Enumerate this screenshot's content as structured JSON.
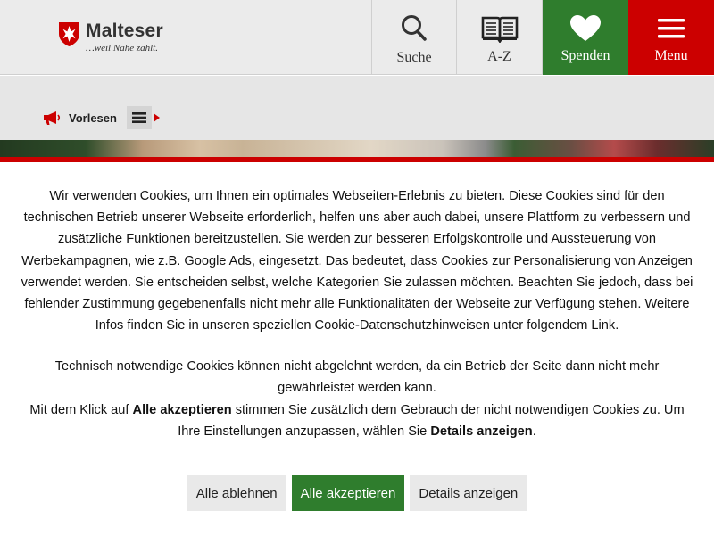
{
  "header": {
    "brand": "Malteser",
    "tagline": "…weil Nähe zählt.",
    "nav": {
      "search_label": "Suche",
      "az_label": "A-Z",
      "donate_label": "Spenden",
      "menu_label": "Menu"
    }
  },
  "toolbar": {
    "read_label": "Vorlesen"
  },
  "consent": {
    "paragraph1": "Wir verwenden Cookies, um Ihnen ein optimales Webseiten-Erlebnis zu bieten. Diese Cookies sind für den technischen Betrieb unserer Webseite erforderlich, helfen uns aber auch dabei, unsere Plattform zu verbessern und zusätzliche Funktionen bereitzustellen. Sie werden zur besseren Erfolgskontrolle und Aussteuerung von Werbekampagnen, wie z.B. Google Ads, eingesetzt. Das bedeutet, dass Cookies zur Personalisierung von Anzeigen verwendet werden. Sie entscheiden selbst, welche Kategorien Sie zulassen möchten. Beachten Sie jedoch, dass bei fehlender Zustimmung gegebenenfalls nicht mehr alle Funktionalitäten der Webseite zur Verfügung stehen. Weitere Infos finden Sie in unseren speziellen Cookie-Datenschutzhinweisen unter folgendem Link.",
    "paragraph2": "Technisch notwendige Cookies können nicht abgelehnt werden, da ein Betrieb der Seite dann nicht mehr gewährleistet werden kann.",
    "paragraph3_prefix": "Mit dem Klick auf ",
    "paragraph3_accept_ref": "Alle akzeptieren",
    "paragraph3_middle": " stimmen Sie zusätzlich dem Gebrauch der nicht notwendigen Cookies zu. Um Ihre Einstellungen anzupassen, wählen Sie ",
    "paragraph3_details_ref": "Details anzeigen",
    "paragraph3_suffix": ".",
    "buttons": {
      "reject_all": "Alle ablehnen",
      "accept_all": "Alle akzeptieren",
      "show_details": "Details anzeigen"
    }
  },
  "colors": {
    "brand_red": "#cc0000",
    "donate_green": "#2f7d2d",
    "header_bg": "#ebebeb"
  },
  "icons": [
    "malteser-cross-icon",
    "search-icon",
    "book-icon",
    "heart-icon",
    "hamburger-icon",
    "megaphone-icon",
    "list-menu-icon",
    "caret-right-icon"
  ]
}
